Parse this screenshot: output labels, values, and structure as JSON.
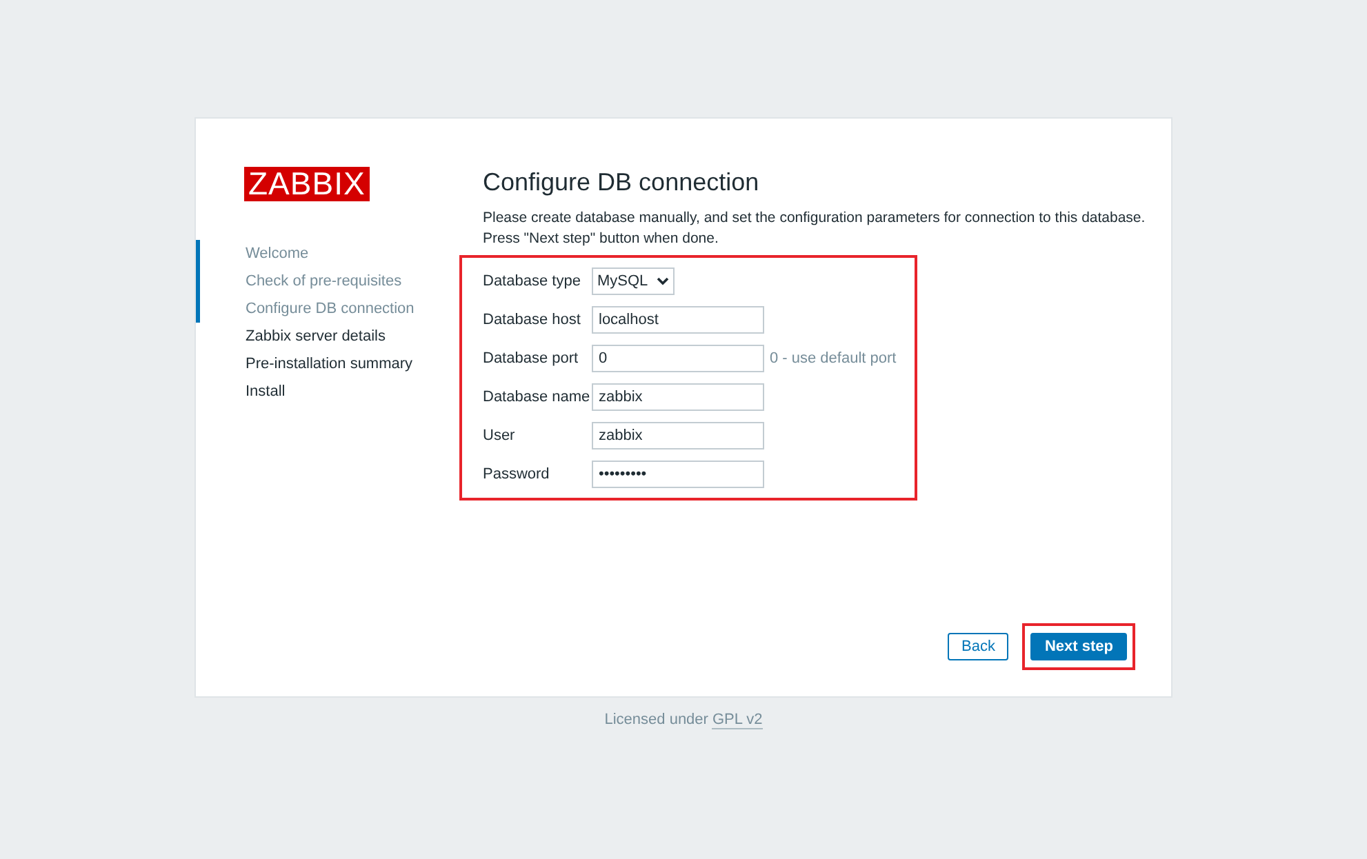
{
  "logo": {
    "text": "ZABBIX"
  },
  "steps": [
    {
      "label": "Welcome",
      "completed": true
    },
    {
      "label": "Check of pre-requisites",
      "completed": true
    },
    {
      "label": "Configure DB connection",
      "completed": true
    },
    {
      "label": "Zabbix server details",
      "completed": false
    },
    {
      "label": "Pre-installation summary",
      "completed": false
    },
    {
      "label": "Install",
      "completed": false
    }
  ],
  "heading": "Configure DB connection",
  "intro": [
    "Please create database manually, and set the configuration parameters for connection to this database.",
    "Press \"Next step\" button when done."
  ],
  "form": {
    "highlighted": true,
    "fields": [
      {
        "kind": "select",
        "label": "Database type",
        "value": "MySQL"
      },
      {
        "kind": "text",
        "label": "Database host",
        "value": "localhost"
      },
      {
        "kind": "text",
        "label": "Database port",
        "value": "0",
        "hint": "0 - use default port"
      },
      {
        "kind": "text",
        "label": "Database name",
        "value": "zabbix"
      },
      {
        "kind": "text",
        "label": "User",
        "value": "zabbix"
      },
      {
        "kind": "text",
        "label": "Password",
        "value": "•••••••••"
      }
    ]
  },
  "buttons": [
    {
      "label": "Back",
      "kind": "secondary",
      "highlighted": false
    },
    {
      "label": "Next step",
      "kind": "primary",
      "highlighted": true
    }
  ],
  "footer": {
    "text": "Licensed under",
    "link": "GPL v2"
  }
}
